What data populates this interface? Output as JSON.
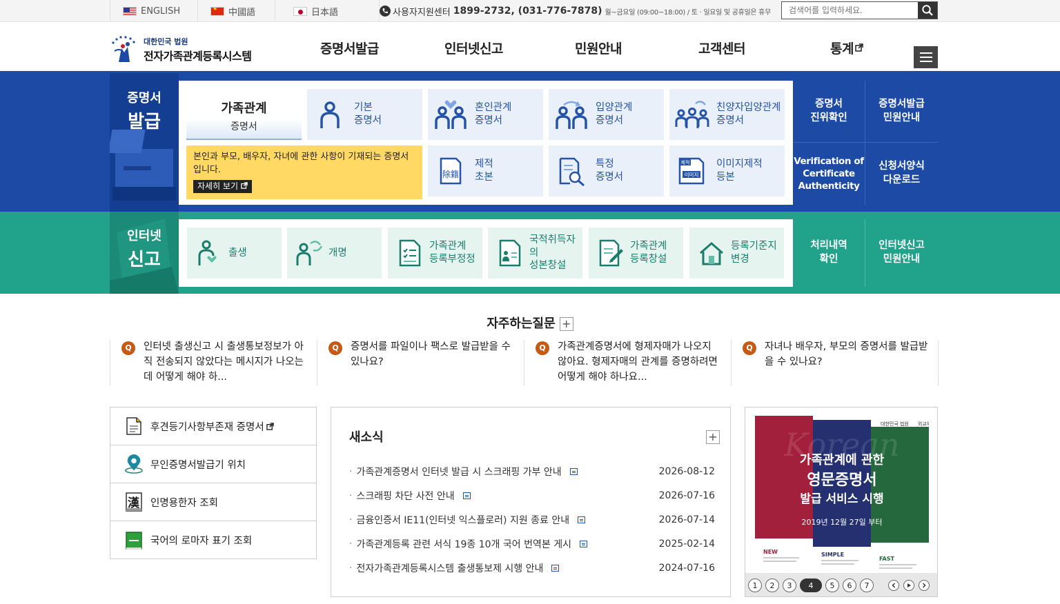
{
  "topbar": {
    "langs": [
      {
        "label": "ENGLISH"
      },
      {
        "label": "中國語"
      },
      {
        "label": "日本語"
      }
    ],
    "contact_label": "사용자지원센터",
    "contact_phone": "1899-2732, (031-776-7878)",
    "contact_hours": "월~금요일 (09:00~18:00) / 토 · 일요일 및 공휴일은 휴무",
    "search_placeholder": "검색어를 입력하세요."
  },
  "header": {
    "logo_top": "대한민국 법원",
    "logo_main": "전자가족관계등록시스템",
    "nav": [
      "증명서발급",
      "인터넷신고",
      "민원안내",
      "고객센터",
      "통계"
    ]
  },
  "issue": {
    "title_a": "증명서",
    "title_b": "발급",
    "active": {
      "title": "가족관계",
      "sub": "증명서"
    },
    "desc": "본인과 부모, 배우자, 자녀에 관한 사항이 기재되는 증명서입니다.",
    "more": "자세히 보기",
    "cards": [
      {
        "l1": "기본",
        "l2": "증명서",
        "icon": "person-icon"
      },
      {
        "l1": "혼인관계",
        "l2": "증명서",
        "icon": "couple-icon"
      },
      {
        "l1": "입양관계",
        "l2": "증명서",
        "icon": "adoption-icon"
      },
      {
        "l1": "친양자입양관계",
        "l2": "증명서",
        "icon": "family-icon"
      },
      {
        "l1": "제적",
        "l2": "초본",
        "icon": "removed-register-icon"
      },
      {
        "l1": "특정",
        "l2": "증명서",
        "icon": "magnifier-doc-icon"
      },
      {
        "l1": "이미지제적",
        "l2": "등본",
        "icon": "image-register-icon"
      }
    ],
    "icon_text_removed": "除籍",
    "icon_text_image": "이미지",
    "icon_text_image_top": "제적",
    "side": [
      {
        "l1": "증명서",
        "l2": "진위확인"
      },
      {
        "l1": "증명서발급",
        "l2": "민원안내"
      },
      {
        "l1": "Verification of",
        "l2": "Certificate",
        "l3": "Authenticity"
      },
      {
        "l1": "신청서양식",
        "l2": "다운로드"
      }
    ]
  },
  "report": {
    "title_a": "인터넷",
    "title_b": "신고",
    "cards": [
      {
        "l1": "출생",
        "l2": ""
      },
      {
        "l1": "개명",
        "l2": ""
      },
      {
        "l1": "가족관계",
        "l2": "등록부정정"
      },
      {
        "l1": "국적취득자의",
        "l2": "성본창설"
      },
      {
        "l1": "가족관계",
        "l2": "등록창설"
      },
      {
        "l1": "등록기준지",
        "l2": "변경"
      }
    ],
    "side": [
      {
        "l1": "처리내역",
        "l2": "확인"
      },
      {
        "l1": "인터넷신고",
        "l2": "민원안내"
      }
    ]
  },
  "faq": {
    "title": "자주하는질문",
    "q_label": "Q",
    "items": [
      "인터넷 출생신고 시 출생통보정보가 아직 전송되지 않았다는 메시지가 나오는데 어떻게 해야 하...",
      "증명서를 파일이나 팩스로 발급받을 수 있나요?",
      "가족관계증명서에 형제자매가 나오지 않아요. 형제자매의 관계를 증명하려면 어떻게 해야 하나요...",
      "자녀나 배우자, 부모의 증명서를 발급받을 수 있나요?"
    ]
  },
  "quick": [
    {
      "label": "후견등기사항부존재 증명서",
      "external": true
    },
    {
      "label": "무인증명서발급기 위치"
    },
    {
      "label": "인명용한자 조회",
      "glyph": "漢"
    },
    {
      "label": "국어의 로마자 표기 조회"
    }
  ],
  "news": {
    "title": "새소식",
    "items": [
      {
        "title": "가족관계증명서 인터넷 발급 시 스크래핑 가부 안내",
        "date": "2026-08-12"
      },
      {
        "title": "스크래핑 차단 사전 안내",
        "date": "2026-07-16"
      },
      {
        "title": "금융인증서 IE11(인터넷 익스플로러) 지원 종료 안내",
        "date": "2026-07-14"
      },
      {
        "title": "가족관계등록 관련 서식 19종 10개 국어 번역본 게시",
        "date": "2025-02-14"
      },
      {
        "title": "전자가족관계등록시스템 출생통보제 시행 안내",
        "date": "2024-07-16"
      }
    ]
  },
  "banner": {
    "org1": "대한민국 법원",
    "org2": "외교부",
    "watermark": "Korean",
    "line1": "가족관계에 관한",
    "line2": "영문증명서",
    "line3": "발급 서비스 시행",
    "date": "2019년 12월 27일 부터",
    "tag1": "NEW",
    "tag2": "SIMPLE",
    "tag3": "FAST",
    "pages": [
      "1",
      "2",
      "3",
      "4",
      "5",
      "6",
      "7"
    ],
    "current_page": "4",
    "colors": {
      "red": "#a3203c",
      "navy": "#24306f",
      "green": "#25683d"
    }
  }
}
